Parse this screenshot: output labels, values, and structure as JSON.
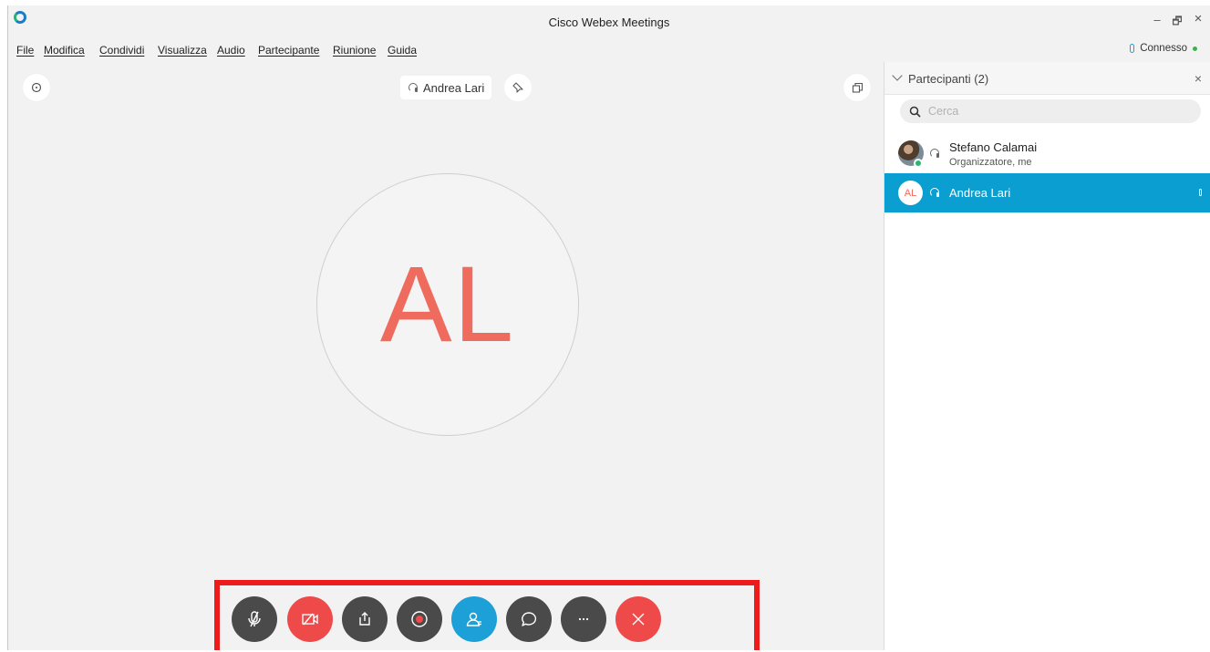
{
  "window": {
    "title": "Cisco Webex Meetings",
    "controls": {
      "minimize": "–",
      "restore": "🗗",
      "close": "×"
    }
  },
  "menu": {
    "items": [
      "File",
      "Modifica",
      "Condividi",
      "Visualizza",
      "Audio",
      "Partecipante",
      "Riunione",
      "Guida"
    ],
    "connection_status": "Connesso"
  },
  "stage": {
    "active_speaker": "Andrea Lari",
    "avatar_initials": "AL",
    "info_icon": "info-icon",
    "layout_icon": "layout-icon"
  },
  "toolbar": {
    "buttons": [
      {
        "name": "mute-button",
        "icon": "mic-off-icon",
        "color": "#4a4a4a"
      },
      {
        "name": "video-button",
        "icon": "video-off-icon",
        "color": "#ef4a4a"
      },
      {
        "name": "share-button",
        "icon": "share-icon",
        "color": "#4a4a4a"
      },
      {
        "name": "record-button",
        "icon": "record-icon",
        "color": "#4a4a4a"
      },
      {
        "name": "participants-button",
        "icon": "participants-icon",
        "color": "#1d9fd8"
      },
      {
        "name": "chat-button",
        "icon": "chat-icon",
        "color": "#4a4a4a"
      },
      {
        "name": "more-button",
        "icon": "more-icon",
        "color": "#4a4a4a"
      },
      {
        "name": "leave-button",
        "icon": "close-icon",
        "color": "#ef4a4a"
      }
    ],
    "highlight_color": "#ee1b1b"
  },
  "panel": {
    "title": "Partecipanti (2)",
    "search_placeholder": "Cerca",
    "participants": [
      {
        "name": "Stefano Calamai",
        "role": "Organizzatore, me",
        "avatar": "photo"
      },
      {
        "name": "Andrea Lari",
        "initials": "AL",
        "selected": true
      }
    ],
    "selected_color": "#0b9fd1"
  }
}
